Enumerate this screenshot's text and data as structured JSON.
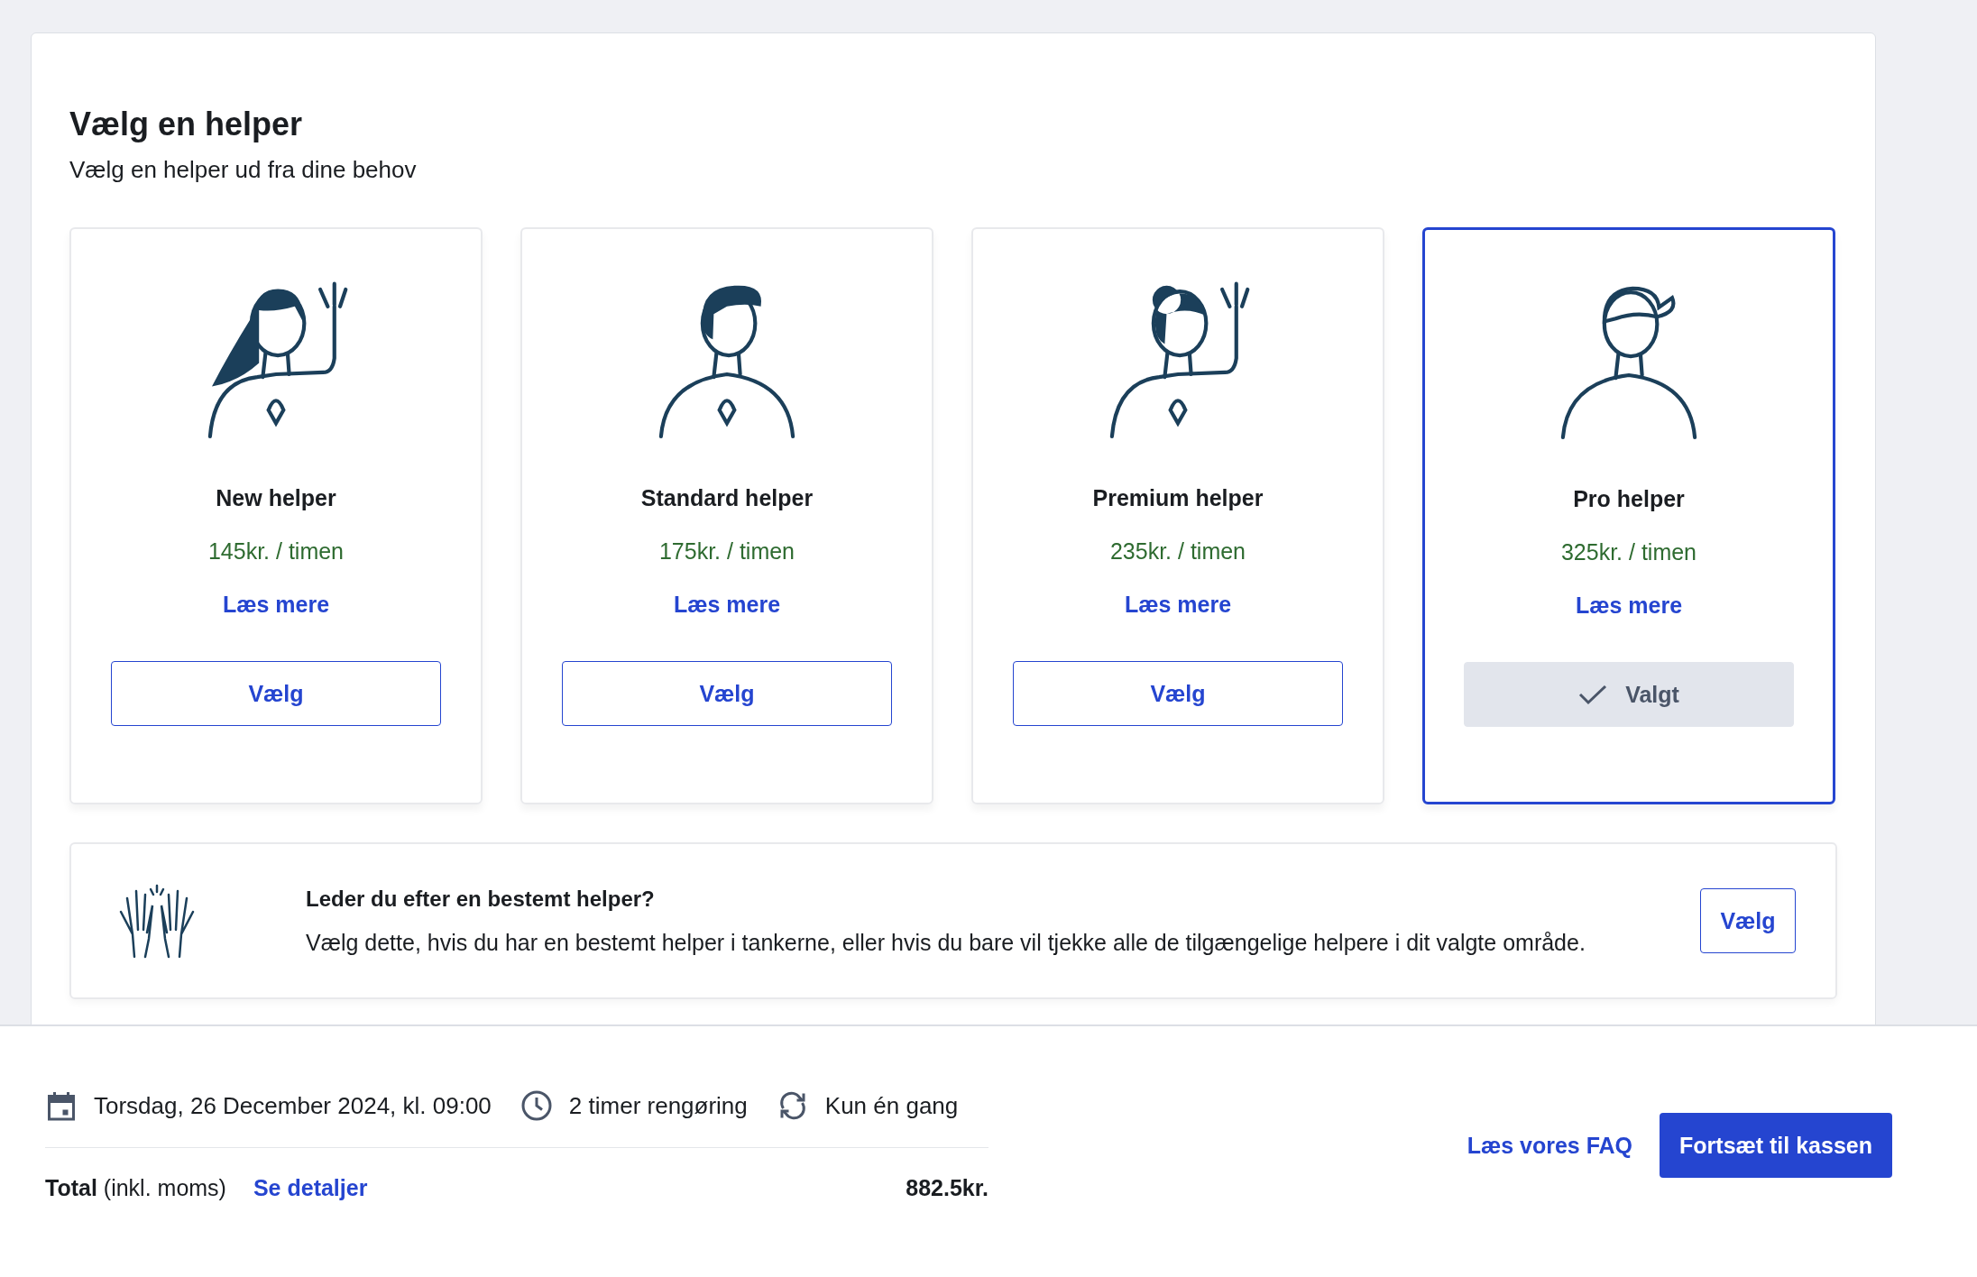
{
  "panel": {
    "title": "Vælg en helper",
    "subtitle": "Vælg en helper ud fra dine behov"
  },
  "helpers": [
    {
      "name": "New helper",
      "price": "145kr. / timen",
      "link": "Læs mere",
      "button": "Vælg",
      "selected": false
    },
    {
      "name": "Standard helper",
      "price": "175kr. / timen",
      "link": "Læs mere",
      "button": "Vælg",
      "selected": false
    },
    {
      "name": "Premium helper",
      "price": "235kr. / timen",
      "link": "Læs mere",
      "button": "Vælg",
      "selected": false
    },
    {
      "name": "Pro helper",
      "price": "325kr. / timen",
      "link": "Læs mere",
      "button": "Valgt",
      "selected": true
    }
  ],
  "specific": {
    "title": "Leder du efter en bestemt helper?",
    "text": "Vælg dette, hvis du har en bestemt helper i tankerne, eller hvis du bare vil tjekke alle de tilgængelige helpere i dit valgte område.",
    "button": "Vælg"
  },
  "summary": {
    "items": [
      {
        "kind": "date",
        "text": "Torsdag, 26 December 2024, kl. 09:00"
      },
      {
        "kind": "duration",
        "text": "2 timer rengøring"
      },
      {
        "kind": "frequency",
        "text": "Kun én gang"
      }
    ],
    "total_label": "**Total** (inkl. moms)",
    "details_link": "Se detaljer",
    "total": "882.5kr.",
    "faq_link": "Læs vores FAQ",
    "checkout_button": "Fortsæt til kassen"
  }
}
